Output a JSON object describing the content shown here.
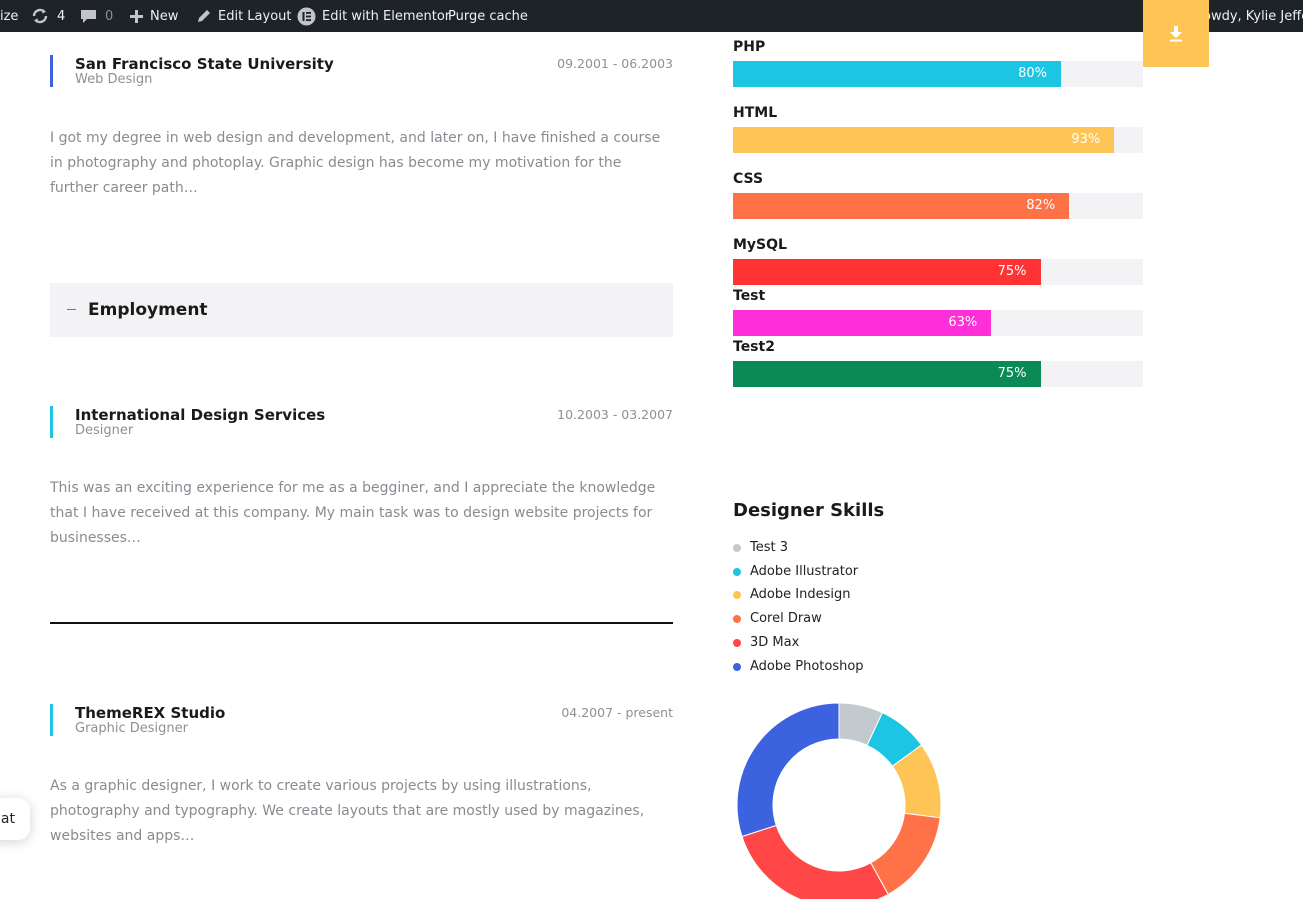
{
  "adminbar": {
    "customize": "ize",
    "updates_count": "4",
    "comments_count": "0",
    "new": "New",
    "edit_layout": "Edit Layout",
    "edit_elementor": "Edit with Elementor",
    "purge_cache": "Purge cache",
    "howdy": "owdy, Kylie Jeffer"
  },
  "education": [
    {
      "title": "San Francisco State University",
      "subtitle": "Web Design",
      "dates": "09.2001 - 06.2003",
      "description": "I got my degree in web design and development, and later on, I have finished a course in photography and photoplay. Graphic design has become my motivation for the further career path…"
    }
  ],
  "employment_section": {
    "label": "Employment"
  },
  "employment": [
    {
      "title": "International Design Services",
      "subtitle": "Designer",
      "dates": "10.2003 - 03.2007",
      "description": "This was an exciting experience for me as a begginer, and I appreciate the knowledge that I have received at this company. My main task was to design website projects for businesses…"
    },
    {
      "title": "ThemeREX Studio",
      "subtitle": "Graphic Designer",
      "dates": "04.2007 - present",
      "description": "As a graphic designer, I work to create various projects by using illustrations, photography and typography. We create layouts that are mostly used by magazines, websites and apps…"
    }
  ],
  "chat": {
    "label": "at"
  },
  "skills": [
    {
      "name": "PHP",
      "percent": 80,
      "label": "80%",
      "color": "#1cc6e2"
    },
    {
      "name": "HTML",
      "percent": 93,
      "label": "93%",
      "color": "#fec456"
    },
    {
      "name": "CSS",
      "percent": 82,
      "label": "82%",
      "color": "#ff7247"
    },
    {
      "name": "MySQL",
      "percent": 75,
      "label": "75%",
      "color": "#ff3333"
    },
    {
      "name": "Test",
      "percent": 63,
      "label": "63%",
      "color": "#fe2ed9"
    },
    {
      "name": "Test2",
      "percent": 75,
      "label": "75%",
      "color": "#0a8a55"
    }
  ],
  "designer_skills": {
    "title": "Designer Skills",
    "legend": [
      {
        "name": "Test 3",
        "color": "#c2cacd"
      },
      {
        "name": "Adobe Illustrator",
        "color": "#1cc6e2"
      },
      {
        "name": "Adobe Indesign",
        "color": "#fec456"
      },
      {
        "name": "Corel Draw",
        "color": "#ff7247"
      },
      {
        "name": "3D Max",
        "color": "#ff4747"
      },
      {
        "name": "Adobe Photoshop",
        "color": "#3d62e0"
      }
    ]
  },
  "chart_data": {
    "type": "pie",
    "categories": [
      "Test 3",
      "Adobe Illustrator",
      "Adobe Indesign",
      "Corel Draw",
      "3D Max",
      "Adobe Photoshop"
    ],
    "values": [
      7,
      8,
      12,
      15,
      28,
      30
    ],
    "colors": [
      "#c2cacd",
      "#1cc6e2",
      "#fec456",
      "#ff7247",
      "#ff4747",
      "#3d62e0"
    ],
    "donut": true
  }
}
